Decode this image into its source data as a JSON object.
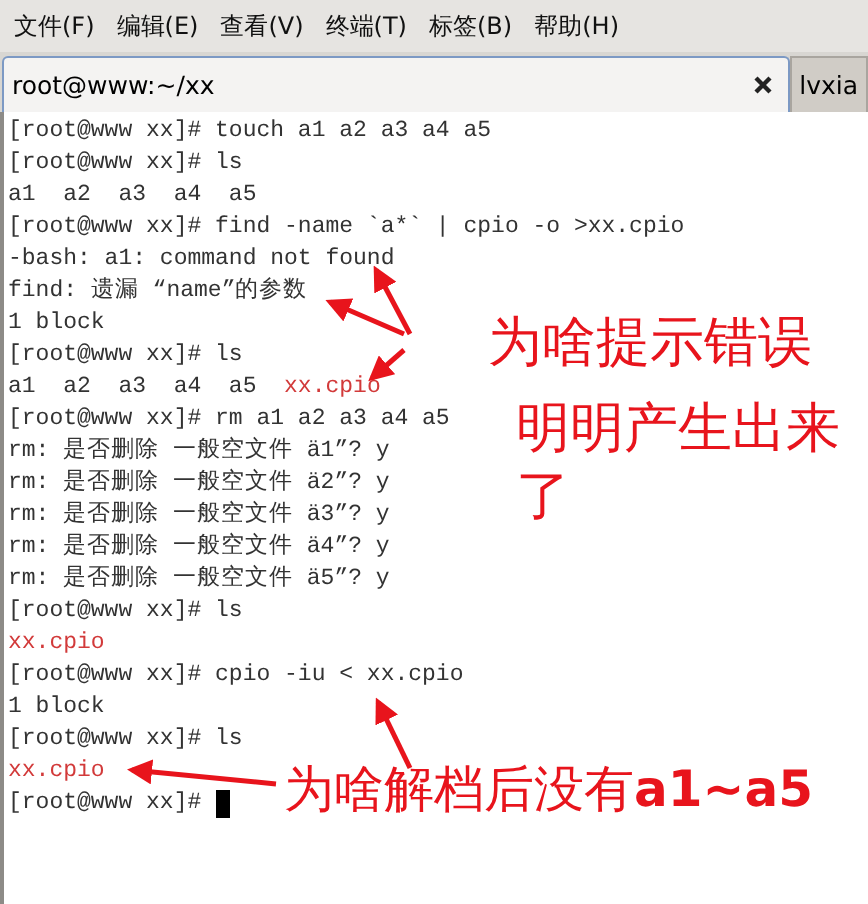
{
  "menu": [
    "文件(F)",
    "编辑(E)",
    "查看(V)",
    "终端(T)",
    "标签(B)",
    "帮助(H)"
  ],
  "tabs": [
    {
      "label": "root@www:~/xx",
      "selected": true
    },
    {
      "label": "lvxia",
      "selected": false
    }
  ],
  "terminal": {
    "lines": [
      [
        {
          "text": "[root@www xx]# touch a1 a2 a3 a4 a5",
          "kind": "plain"
        }
      ],
      [
        {
          "text": "[root@www xx]# ls",
          "kind": "plain"
        }
      ],
      [
        {
          "text": "a1  a2  a3  a4  a5",
          "kind": "plain"
        }
      ],
      [
        {
          "text": "[root@www xx]# find -name `a*` | cpio -o >xx.cpio",
          "kind": "plain"
        }
      ],
      [
        {
          "text": "-bash: a1: command not found",
          "kind": "plain"
        }
      ],
      [
        {
          "text": "find: 遗漏 “name”的参数",
          "kind": "plain"
        }
      ],
      [
        {
          "text": "1 block",
          "kind": "plain"
        }
      ],
      [
        {
          "text": "[root@www xx]# ls",
          "kind": "plain"
        }
      ],
      [
        {
          "text": "a1  a2  a3  a4  a5  ",
          "kind": "plain"
        },
        {
          "text": "xx.cpio",
          "kind": "archive"
        }
      ],
      [
        {
          "text": "[root@www xx]# rm a1 a2 a3 a4 a5",
          "kind": "plain"
        }
      ],
      [
        {
          "text": "rm: 是否删除 一般空文件 ä1”? y",
          "kind": "plain"
        }
      ],
      [
        {
          "text": "rm: 是否删除 一般空文件 ä2”? y",
          "kind": "plain"
        }
      ],
      [
        {
          "text": "rm: 是否删除 一般空文件 ä3”? y",
          "kind": "plain"
        }
      ],
      [
        {
          "text": "rm: 是否删除 一般空文件 ä4”? y",
          "kind": "plain"
        }
      ],
      [
        {
          "text": "rm: 是否删除 一般空文件 ä5”? y",
          "kind": "plain"
        }
      ],
      [
        {
          "text": "[root@www xx]# ls",
          "kind": "plain"
        }
      ],
      [
        {
          "text": "xx.cpio",
          "kind": "archive"
        }
      ],
      [
        {
          "text": "[root@www xx]# cpio -iu < xx.cpio",
          "kind": "plain"
        }
      ],
      [
        {
          "text": "1 block",
          "kind": "plain"
        }
      ],
      [
        {
          "text": "[root@www xx]# ls",
          "kind": "plain"
        }
      ],
      [
        {
          "text": "xx.cpio",
          "kind": "archive"
        }
      ],
      [
        {
          "text": "[root@www xx]# ",
          "kind": "plain"
        }
      ]
    ],
    "cursor": true
  },
  "annotations": [
    "为啥提示错误",
    "明明产生出来了",
    "为啥解档后没有**a1~a5**"
  ]
}
